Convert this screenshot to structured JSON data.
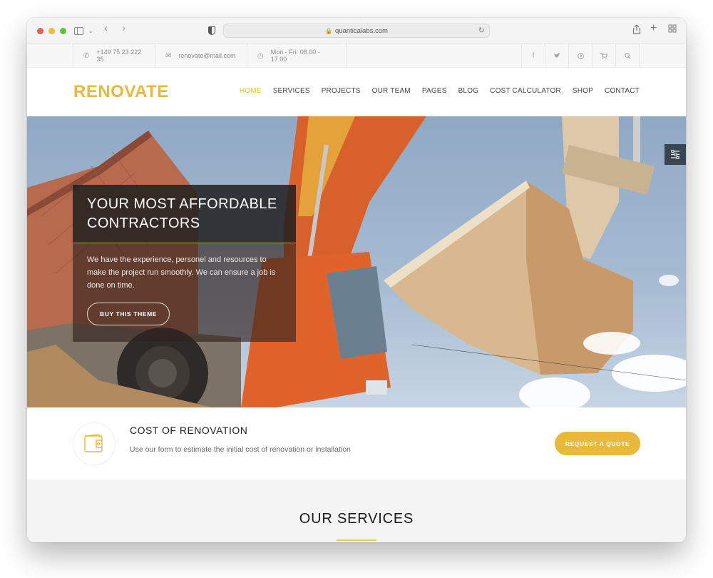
{
  "browser": {
    "url": "quanticalabs.com",
    "icons": [
      "sidebar-icon",
      "chevron-down-icon",
      "back-icon",
      "forward-icon",
      "shield-icon",
      "lock-icon",
      "reload-icon",
      "share-icon",
      "new-tab-icon",
      "tab-overview-icon"
    ]
  },
  "topbar": {
    "phone": "+149 75 23 222 35",
    "email": "renovate@mail.com",
    "hours": "Mon - Fri: 08.00 - 17.00",
    "social_icons": [
      "facebook-icon",
      "twitter-icon",
      "pinterest-icon",
      "cart-icon",
      "search-icon"
    ]
  },
  "header": {
    "logo": "RENOVATE",
    "nav": [
      {
        "label": "HOME",
        "active": true
      },
      {
        "label": "SERVICES"
      },
      {
        "label": "PROJECTS"
      },
      {
        "label": "OUR TEAM"
      },
      {
        "label": "PAGES"
      },
      {
        "label": "BLOG"
      },
      {
        "label": "COST CALCULATOR"
      },
      {
        "label": "SHOP"
      },
      {
        "label": "CONTACT"
      }
    ]
  },
  "hero": {
    "title_line1": "YOUR MOST AFFORDABLE",
    "title_line2": "CONTRACTORS",
    "text": "We have the experience, personel and resources to make the project run smoothly. We can ensure a job is done on time.",
    "button": "BUY THIS THEME"
  },
  "cost": {
    "title": "COST OF RENOVATION",
    "text": "Use our form to estimate the initial cost of renovation or installation",
    "button": "REQUEST A QUOTE"
  },
  "services": {
    "title": "OUR SERVICES"
  },
  "colors": {
    "accent": "#e8b93b",
    "dark_panel": "#1e1e1e",
    "settings_tab": "#3a4552"
  }
}
